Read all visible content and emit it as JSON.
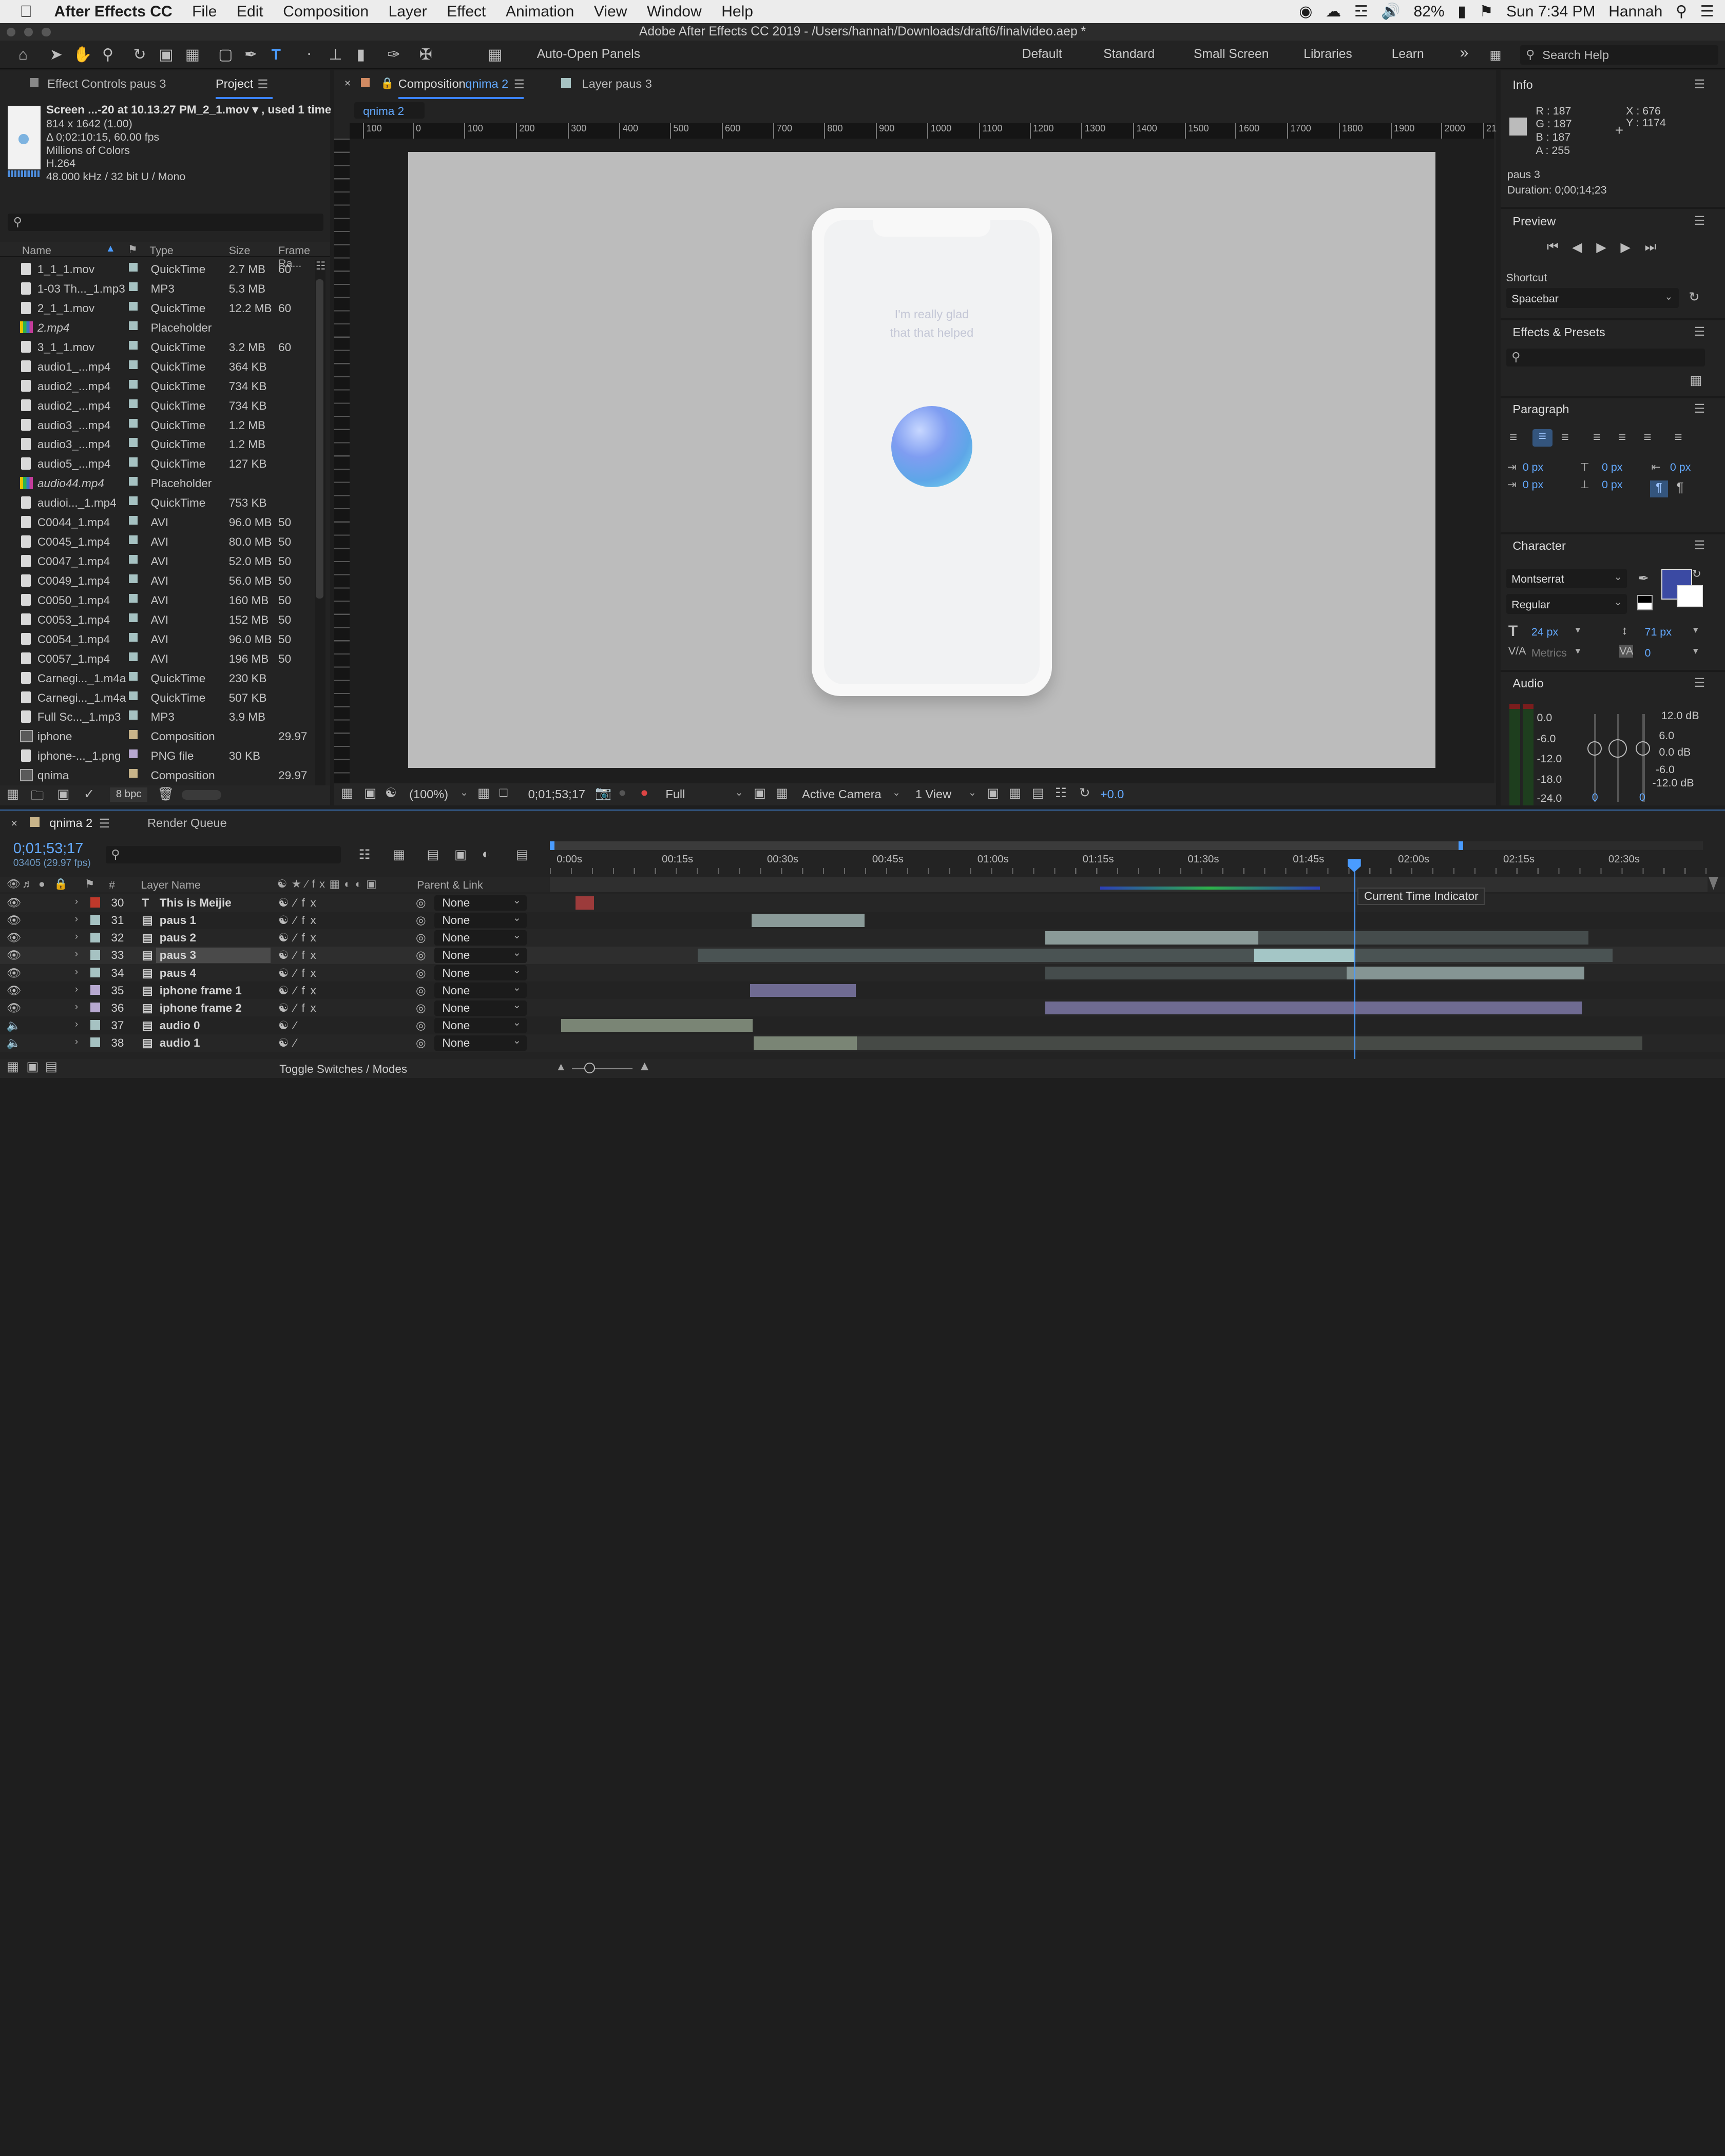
{
  "menubar": {
    "apple": "",
    "app": "After Effects CC",
    "items": [
      "File",
      "Edit",
      "Composition",
      "Layer",
      "Effect",
      "Animation",
      "View",
      "Window",
      "Help"
    ],
    "battery": "82%",
    "datetime": "Sun 7:34 PM",
    "user": "Hannah"
  },
  "title": "Adobe After Effects CC 2019 - /Users/hannah/Downloads/draft6/finalvideo.aep *",
  "toolbar": {
    "auto_open": "Auto-Open Panels",
    "workspaces": [
      "Default",
      "Standard",
      "Small Screen",
      "Libraries",
      "Learn"
    ],
    "search_placeholder": "Search Help"
  },
  "project": {
    "tab_effect": "Effect Controls paus 3",
    "tab_project": "Project",
    "footage_name": "Screen ...-20 at 10.13.27 PM_2_1.mov ▾ , used 1 time",
    "meta": [
      "814 x 1642 (1.00)",
      "Δ 0;02:10:15, 60.00 fps",
      "Millions of Colors",
      "H.264",
      "48.000 kHz / 32 bit U / Mono"
    ],
    "columns": [
      "Name",
      "Type",
      "Size",
      "Frame Ra..."
    ],
    "rows": [
      {
        "name": "1_1_1.mov",
        "type": "QuickTime",
        "size": "2.7 MB",
        "fps": "60",
        "icon": "file",
        "color": "#a6c2c2"
      },
      {
        "name": "1-03 Th..._1.mp3",
        "type": "MP3",
        "size": "5.3 MB",
        "fps": "",
        "icon": "file",
        "color": "#a6c2c2"
      },
      {
        "name": "2_1_1.mov",
        "type": "QuickTime",
        "size": "12.2 MB",
        "fps": "60",
        "icon": "file",
        "color": "#a6c2c2"
      },
      {
        "name": "2.mp4",
        "type": "Placeholder",
        "size": "",
        "fps": "",
        "icon": "ph",
        "color": "#a6c2c2"
      },
      {
        "name": "3_1_1.mov",
        "type": "QuickTime",
        "size": "3.2 MB",
        "fps": "60",
        "icon": "file",
        "color": "#a6c2c2"
      },
      {
        "name": "audio1_...mp4",
        "type": "QuickTime",
        "size": "364 KB",
        "fps": "",
        "icon": "file",
        "color": "#a6c2c2"
      },
      {
        "name": "audio2_...mp4",
        "type": "QuickTime",
        "size": "734 KB",
        "fps": "",
        "icon": "file",
        "color": "#a6c2c2"
      },
      {
        "name": "audio2_...mp4",
        "type": "QuickTime",
        "size": "734 KB",
        "fps": "",
        "icon": "file",
        "color": "#a6c2c2"
      },
      {
        "name": "audio3_...mp4",
        "type": "QuickTime",
        "size": "1.2 MB",
        "fps": "",
        "icon": "file",
        "color": "#a6c2c2"
      },
      {
        "name": "audio3_...mp4",
        "type": "QuickTime",
        "size": "1.2 MB",
        "fps": "",
        "icon": "file",
        "color": "#a6c2c2"
      },
      {
        "name": "audio5_...mp4",
        "type": "QuickTime",
        "size": "127 KB",
        "fps": "",
        "icon": "file",
        "color": "#a6c2c2"
      },
      {
        "name": "audio44.mp4",
        "type": "Placeholder",
        "size": "",
        "fps": "",
        "icon": "ph",
        "color": "#a6c2c2"
      },
      {
        "name": "audioi..._1.mp4",
        "type": "QuickTime",
        "size": "753 KB",
        "fps": "",
        "icon": "file",
        "color": "#a6c2c2"
      },
      {
        "name": "C0044_1.mp4",
        "type": "AVI",
        "size": "96.0 MB",
        "fps": "50",
        "icon": "file",
        "color": "#a6c2c2"
      },
      {
        "name": "C0045_1.mp4",
        "type": "AVI",
        "size": "80.0 MB",
        "fps": "50",
        "icon": "file",
        "color": "#a6c2c2"
      },
      {
        "name": "C0047_1.mp4",
        "type": "AVI",
        "size": "52.0 MB",
        "fps": "50",
        "icon": "file",
        "color": "#a6c2c2"
      },
      {
        "name": "C0049_1.mp4",
        "type": "AVI",
        "size": "56.0 MB",
        "fps": "50",
        "icon": "file",
        "color": "#a6c2c2"
      },
      {
        "name": "C0050_1.mp4",
        "type": "AVI",
        "size": "160 MB",
        "fps": "50",
        "icon": "file",
        "color": "#a6c2c2"
      },
      {
        "name": "C0053_1.mp4",
        "type": "AVI",
        "size": "152 MB",
        "fps": "50",
        "icon": "file",
        "color": "#a6c2c2"
      },
      {
        "name": "C0054_1.mp4",
        "type": "AVI",
        "size": "96.0 MB",
        "fps": "50",
        "icon": "file",
        "color": "#a6c2c2"
      },
      {
        "name": "C0057_1.mp4",
        "type": "AVI",
        "size": "196 MB",
        "fps": "50",
        "icon": "file",
        "color": "#a6c2c2"
      },
      {
        "name": "Carnegi..._1.m4a",
        "type": "QuickTime",
        "size": "230 KB",
        "fps": "",
        "icon": "file",
        "color": "#a6c2c2"
      },
      {
        "name": "Carnegi..._1.m4a",
        "type": "QuickTime",
        "size": "507 KB",
        "fps": "",
        "icon": "file",
        "color": "#a6c2c2"
      },
      {
        "name": "Full Sc..._1.mp3",
        "type": "MP3",
        "size": "3.9 MB",
        "fps": "",
        "icon": "file",
        "color": "#a6c2c2"
      },
      {
        "name": "iphone",
        "type": "Composition",
        "size": "",
        "fps": "29.97",
        "icon": "comp",
        "color": "#c8b48a"
      },
      {
        "name": "iphone-..._1.png",
        "type": "PNG file",
        "size": "30 KB",
        "fps": "",
        "icon": "file",
        "color": "#b7a8d0"
      },
      {
        "name": "qnima",
        "type": "Composition",
        "size": "",
        "fps": "29.97",
        "icon": "comp",
        "color": "#c8b48a"
      }
    ],
    "bpc": "8 bpc"
  },
  "comp": {
    "tab_comp_prefix": "Composition",
    "tab_comp_name": "qnima 2",
    "tab_layer": "Layer paus 3",
    "breadcrumb": "qnima 2",
    "ruler": [
      "100",
      "0",
      "100",
      "200",
      "300",
      "400",
      "500",
      "600",
      "700",
      "800",
      "900",
      "1000",
      "1100",
      "1200",
      "1300",
      "1400",
      "1500",
      "1600",
      "1700",
      "1800",
      "1900",
      "2000",
      "21"
    ],
    "phone_text": [
      "I'm really glad",
      "that that helped"
    ],
    "zoom": "(100%)",
    "timecode": "0;01;53;17",
    "resolution": "Full",
    "camera": "Active Camera",
    "views": "1 View",
    "exposure": "+0.0"
  },
  "info": {
    "title": "Info",
    "rgba": [
      "R : 187",
      "G : 187",
      "B : 187",
      "A : 255"
    ],
    "xy": [
      "X : 676",
      "Y : 1174"
    ],
    "layer": "paus 3",
    "duration": "Duration: 0;00;14;23"
  },
  "preview": {
    "title": "Preview",
    "shortcut_label": "Shortcut",
    "shortcut": "Spacebar"
  },
  "effects": {
    "title": "Effects & Presets"
  },
  "paragraph": {
    "title": "Paragraph",
    "vals": [
      "0 px",
      "0 px",
      "0 px",
      "0 px",
      "0 px"
    ]
  },
  "character": {
    "title": "Character",
    "font": "Montserrat",
    "style": "Regular",
    "size": "24 px",
    "leading": "71 px",
    "kerning": "Metrics",
    "tracking": "0",
    "fill_color": "#3b4aa3"
  },
  "audio": {
    "title": "Audio",
    "left": [
      "0.0",
      "-6.0",
      "-12.0",
      "-18.0",
      "-24.0"
    ],
    "right": [
      "12.0 dB",
      "6.0",
      "0.0 dB",
      "-6.0",
      "-12.0 dB"
    ],
    "bottom": [
      "0",
      "0"
    ]
  },
  "timeline": {
    "tab_comp": "qnima 2",
    "tab_render": "Render Queue",
    "timecode": "0;01;53;17",
    "frames": "03405 (29.97 fps)",
    "ruler": [
      "0:00s",
      "00:15s",
      "00:30s",
      "00:45s",
      "01:00s",
      "01:15s",
      "01:30s",
      "01:45s",
      "02:00s",
      "02:15s",
      "02:30s"
    ],
    "header": {
      "num": "#",
      "name": "Layer Name",
      "parent": "Parent & Link"
    },
    "tooltip": "Current Time Indicator",
    "layers": [
      {
        "num": "30",
        "name": "This is Meijie",
        "type": "T",
        "label": "#c0392b",
        "parent": "None",
        "selected": false
      },
      {
        "num": "31",
        "name": "paus 1",
        "type": "footage",
        "label": "#a6c2c2",
        "parent": "None",
        "selected": false
      },
      {
        "num": "32",
        "name": "paus 2",
        "type": "footage",
        "label": "#a6c2c2",
        "parent": "None",
        "selected": false
      },
      {
        "num": "33",
        "name": "paus 3",
        "type": "footage",
        "label": "#a6c2c2",
        "parent": "None",
        "selected": true
      },
      {
        "num": "34",
        "name": "paus 4",
        "type": "footage",
        "label": "#a6c2c2",
        "parent": "None",
        "selected": false
      },
      {
        "num": "35",
        "name": "iphone frame 1",
        "type": "footage",
        "label": "#b7a8d0",
        "parent": "None",
        "selected": false
      },
      {
        "num": "36",
        "name": "iphone frame 2",
        "type": "footage",
        "label": "#b7a8d0",
        "parent": "None",
        "selected": false
      },
      {
        "num": "37",
        "name": "audio 0",
        "type": "footage",
        "label": "#a6c2c2",
        "parent": "None",
        "selected": false
      },
      {
        "num": "38",
        "name": "audio 1",
        "type": "footage",
        "label": "#a6c2c2",
        "parent": "None",
        "selected": false
      }
    ],
    "bottom": "Toggle Switches / Modes"
  }
}
